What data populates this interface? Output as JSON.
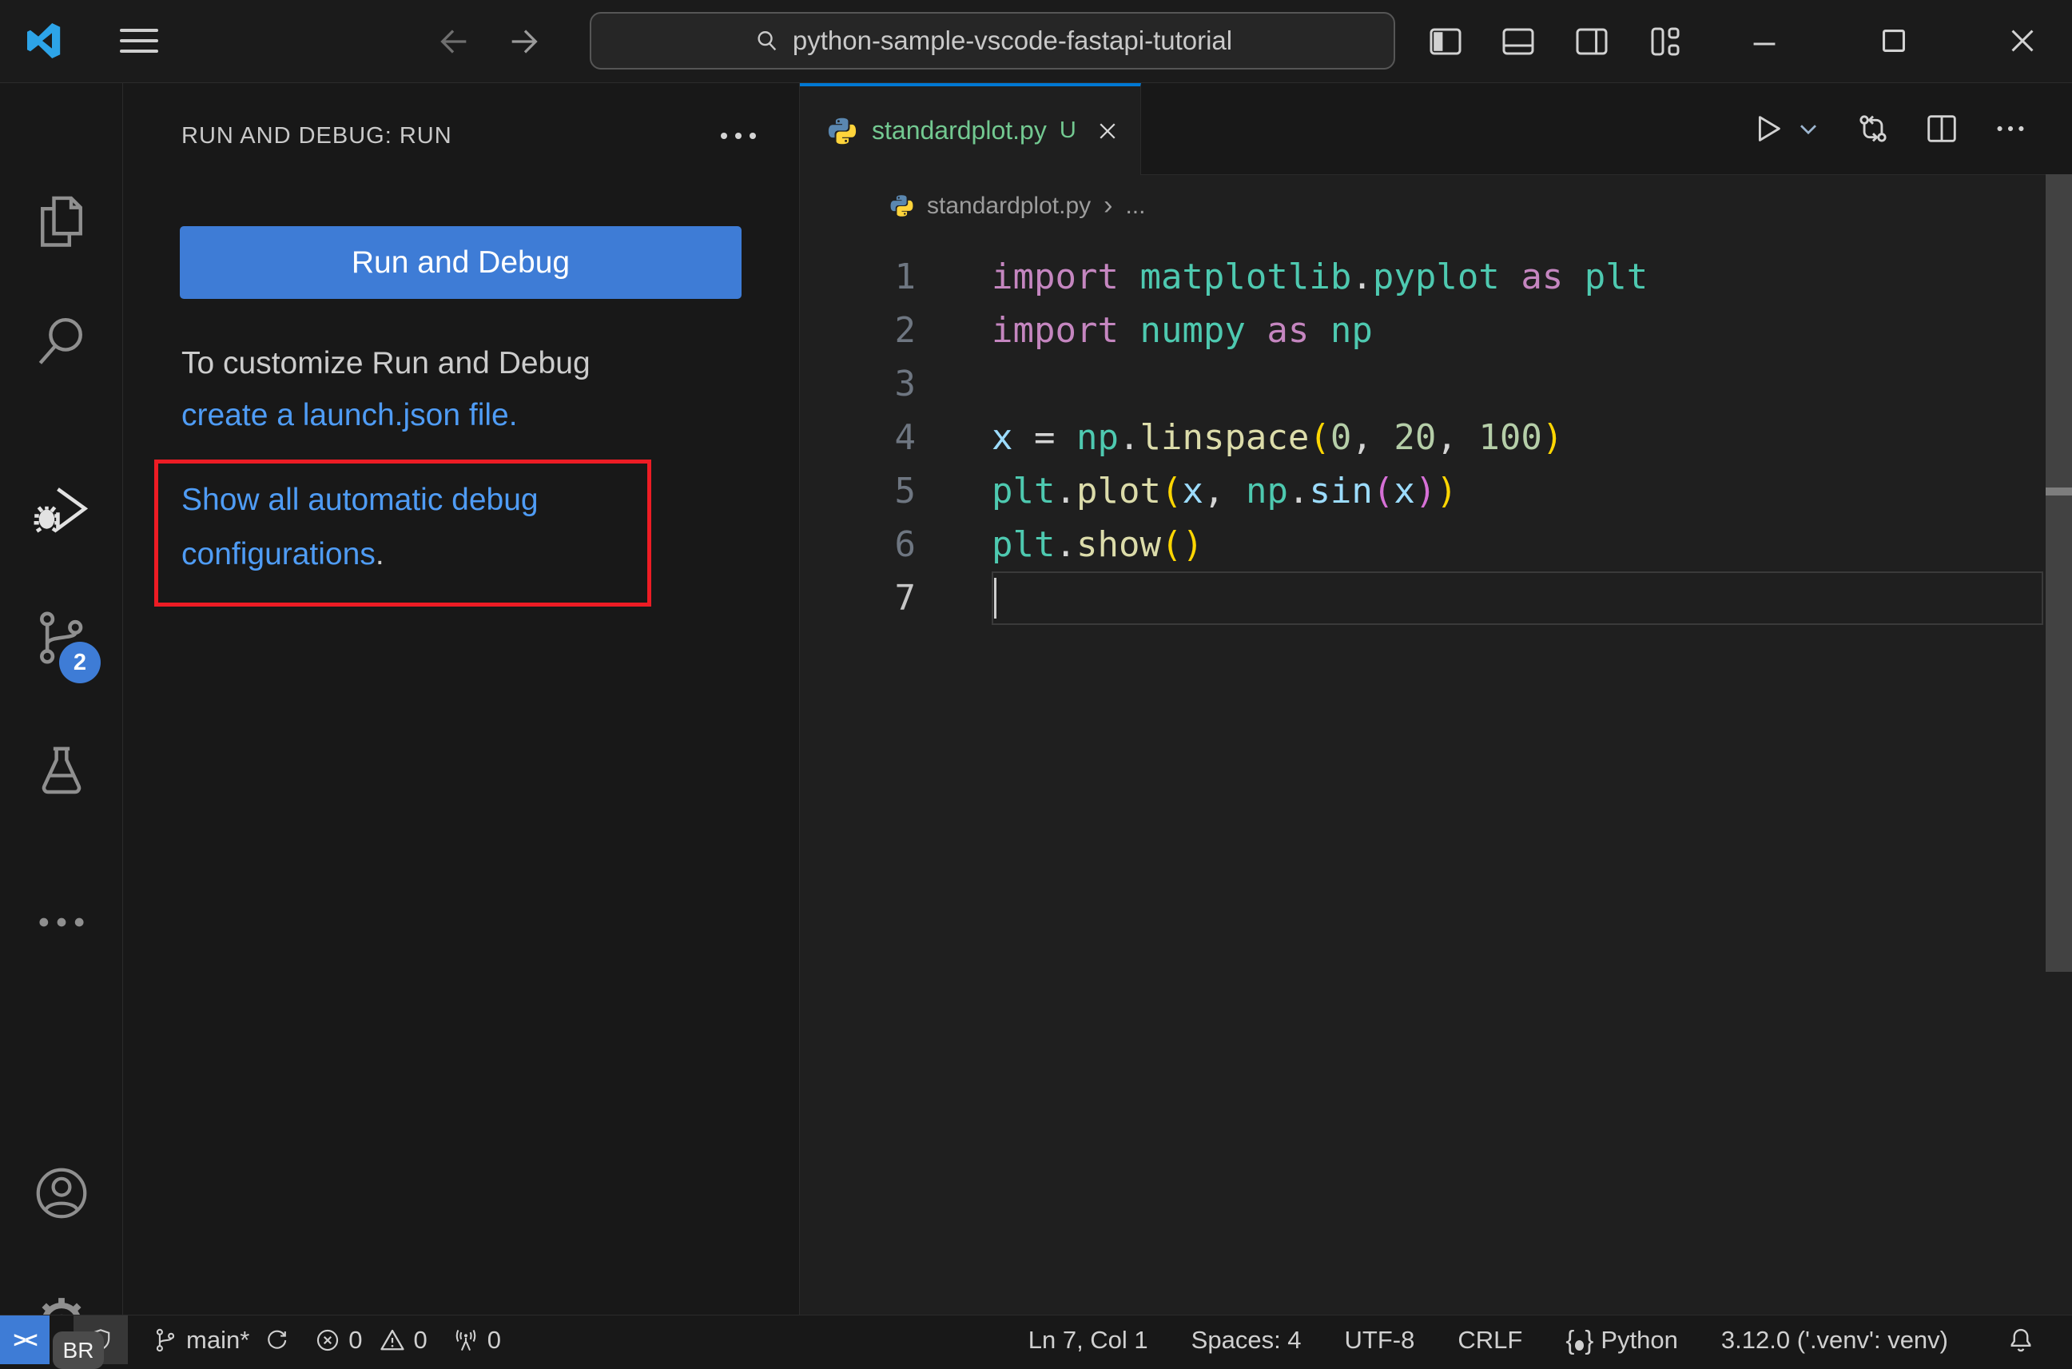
{
  "title_bar": {
    "command_center_text": "python-sample-vscode-fastapi-tutorial"
  },
  "activity_bar": {
    "scm_badge": "2",
    "settings_badge": "BR"
  },
  "sidebar": {
    "title": "RUN AND DEBUG: RUN",
    "run_button_label": "Run and Debug",
    "customize_text": "To customize Run and Debug",
    "create_launch_link": "create a launch.json file.",
    "show_configs_line1": "Show all automatic debug",
    "show_configs_line2": "configurations",
    "show_configs_period": "."
  },
  "editor": {
    "tab_label": "standardplot.py",
    "tab_dirty": "U",
    "breadcrumb_file": "standardplot.py",
    "breadcrumb_more": "...",
    "code_lines": [
      {
        "num": "1",
        "tokens": [
          [
            "import",
            "kw"
          ],
          [
            " ",
            "plain"
          ],
          [
            "matplotlib",
            "type"
          ],
          [
            ".",
            "plain"
          ],
          [
            "pyplot",
            "type"
          ],
          [
            " ",
            "plain"
          ],
          [
            "as",
            "kw"
          ],
          [
            " ",
            "plain"
          ],
          [
            "plt",
            "type"
          ]
        ]
      },
      {
        "num": "2",
        "tokens": [
          [
            "import",
            "kw"
          ],
          [
            " ",
            "plain"
          ],
          [
            "numpy",
            "type"
          ],
          [
            " ",
            "plain"
          ],
          [
            "as",
            "kw"
          ],
          [
            " ",
            "plain"
          ],
          [
            "np",
            "type"
          ]
        ]
      },
      {
        "num": "3",
        "tokens": []
      },
      {
        "num": "4",
        "tokens": [
          [
            "x",
            "var"
          ],
          [
            " ",
            "plain"
          ],
          [
            "=",
            "plain"
          ],
          [
            " ",
            "plain"
          ],
          [
            "np",
            "type"
          ],
          [
            ".",
            "plain"
          ],
          [
            "linspace",
            "fn"
          ],
          [
            "(",
            "b1"
          ],
          [
            "0",
            "num"
          ],
          [
            ",",
            "plain"
          ],
          [
            " ",
            "plain"
          ],
          [
            "20",
            "num"
          ],
          [
            ",",
            "plain"
          ],
          [
            " ",
            "plain"
          ],
          [
            "100",
            "num"
          ],
          [
            ")",
            "b1"
          ]
        ]
      },
      {
        "num": "5",
        "tokens": [
          [
            "plt",
            "type"
          ],
          [
            ".",
            "plain"
          ],
          [
            "plot",
            "fn"
          ],
          [
            "(",
            "b1"
          ],
          [
            "x",
            "var"
          ],
          [
            ",",
            "plain"
          ],
          [
            " ",
            "plain"
          ],
          [
            "np",
            "type"
          ],
          [
            ".",
            "plain"
          ],
          [
            "sin",
            "var"
          ],
          [
            "(",
            "b2"
          ],
          [
            "x",
            "var"
          ],
          [
            ")",
            "b2"
          ],
          [
            ")",
            "b1"
          ]
        ]
      },
      {
        "num": "6",
        "tokens": [
          [
            "plt",
            "type"
          ],
          [
            ".",
            "plain"
          ],
          [
            "show",
            "fn"
          ],
          [
            "(",
            "b1"
          ],
          [
            ")",
            "b1"
          ]
        ]
      },
      {
        "num": "7",
        "tokens": [],
        "current": true
      }
    ]
  },
  "status_bar": {
    "branch": "main*",
    "errors": "0",
    "warnings": "0",
    "ports": "0",
    "cursor_position": "Ln 7, Col 1",
    "indentation": "Spaces: 4",
    "encoding": "UTF-8",
    "eol": "CRLF",
    "language": "Python",
    "interpreter": "3.12.0 ('.venv': venv)"
  },
  "colors": {
    "accent_blue": "#0078d4",
    "button_blue": "#3e7cd6",
    "link_blue": "#4f9cf5",
    "git_untracked_green": "#73c991",
    "highlight_red": "#ed1c24",
    "editor_background": "#1f1f1f",
    "shell_background": "#181818"
  }
}
